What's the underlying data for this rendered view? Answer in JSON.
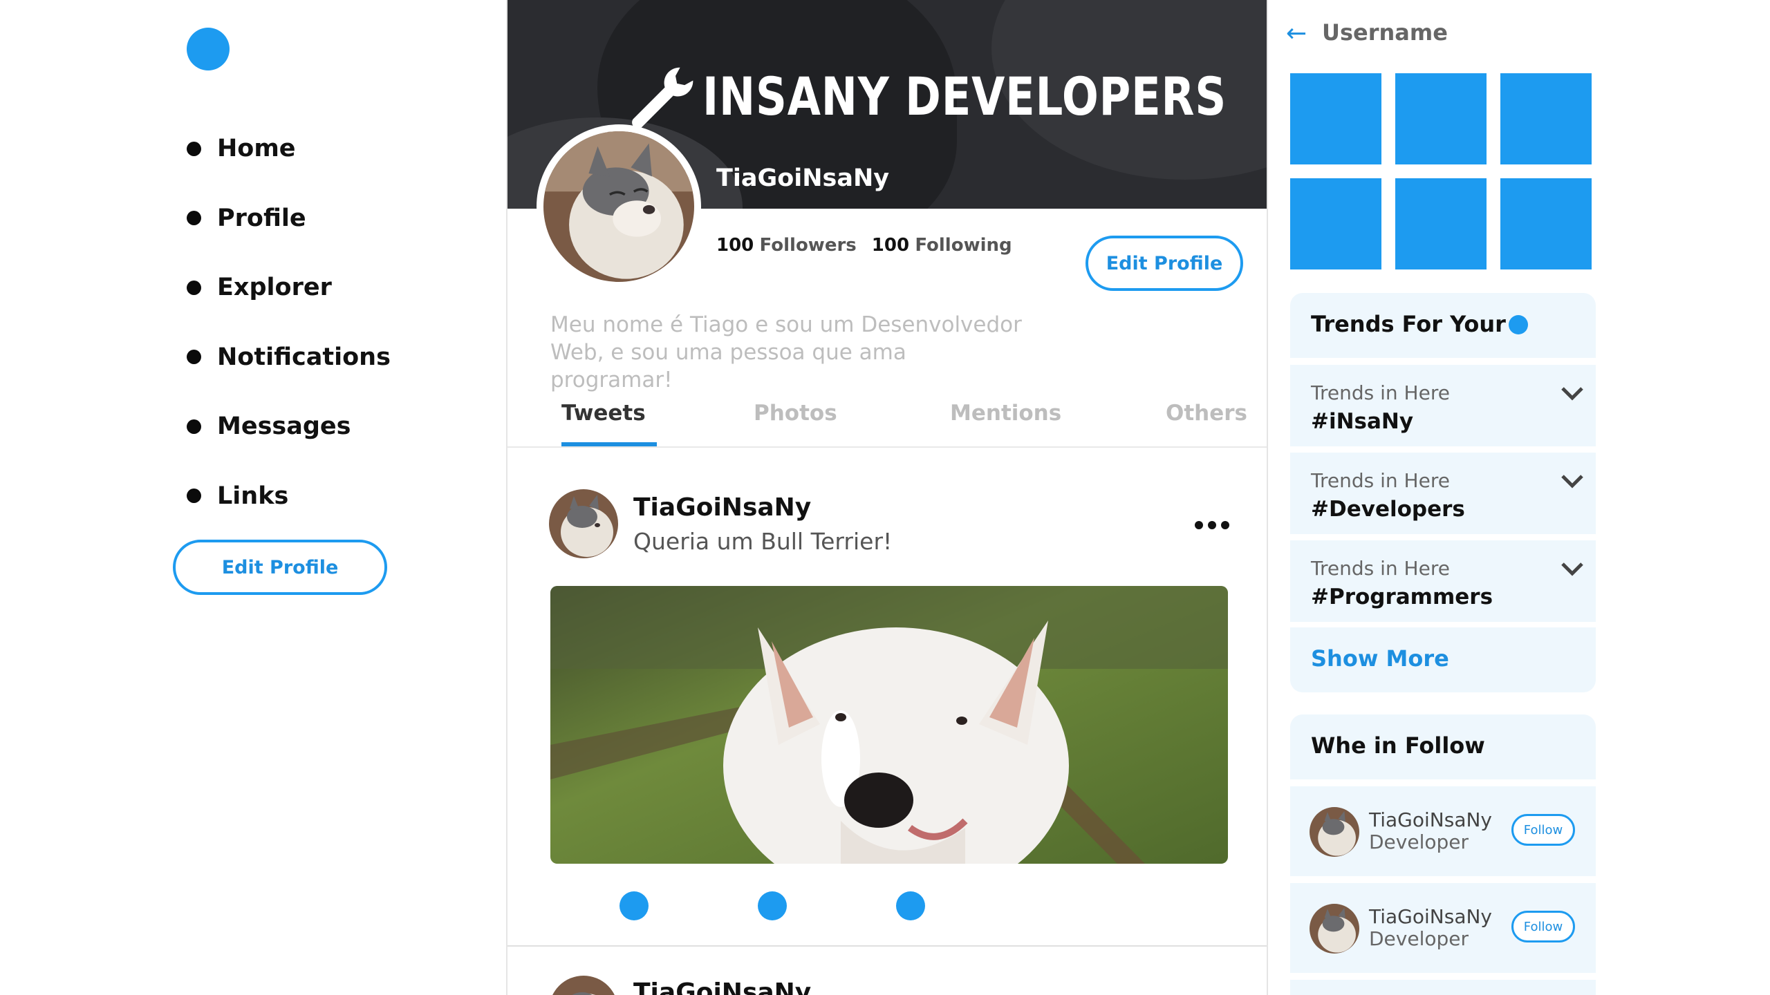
{
  "nav": {
    "items": [
      {
        "label": "Home"
      },
      {
        "label": "Profile"
      },
      {
        "label": "Explorer"
      },
      {
        "label": "Notifications"
      },
      {
        "label": "Messages"
      },
      {
        "label": "Links"
      }
    ],
    "edit_profile_label": "Edit Profile"
  },
  "profile": {
    "brand_title": "INSANY DEVELOPERS",
    "username": "TiaGoiNsaNy",
    "followers_count": "100",
    "followers_label": "Followers",
    "following_count": "100",
    "following_label": "Following",
    "edit_profile_label": "Edit Profile",
    "bio_line1": "Meu nome é Tiago e sou um Desenvolvedor",
    "bio_line2": "Web, e sou uma pessoa que ama programar!"
  },
  "tabs": [
    {
      "label": "Tweets",
      "active": true
    },
    {
      "label": "Photos",
      "active": false
    },
    {
      "label": "Mentions",
      "active": false
    },
    {
      "label": "Others",
      "active": false
    }
  ],
  "tweets": [
    {
      "user": "TiaGoiNsaNy",
      "text": "Queria um Bull Terrier!"
    },
    {
      "user": "TiaGoiNsaNy",
      "text": ""
    }
  ],
  "right": {
    "username": "Username",
    "trends_title": "Trends For Your",
    "trends": [
      {
        "sub": "Trends in Here",
        "tag": "#iNsaNy"
      },
      {
        "sub": "Trends in Here",
        "tag": "#Developers"
      },
      {
        "sub": "Trends in Here",
        "tag": "#Programmers"
      }
    ],
    "show_more": "Show More",
    "follow_title": "Whe in Follow",
    "follow": [
      {
        "name": "TiaGoiNsaNy",
        "role": "Developer",
        "button": "Follow"
      },
      {
        "name": "TiaGoiNsaNy",
        "role": "Developer",
        "button": "Follow"
      }
    ]
  },
  "colors": {
    "accent": "#1d9bf0",
    "cover": "#2b2c30",
    "panel_bg": "#eef7fd"
  }
}
